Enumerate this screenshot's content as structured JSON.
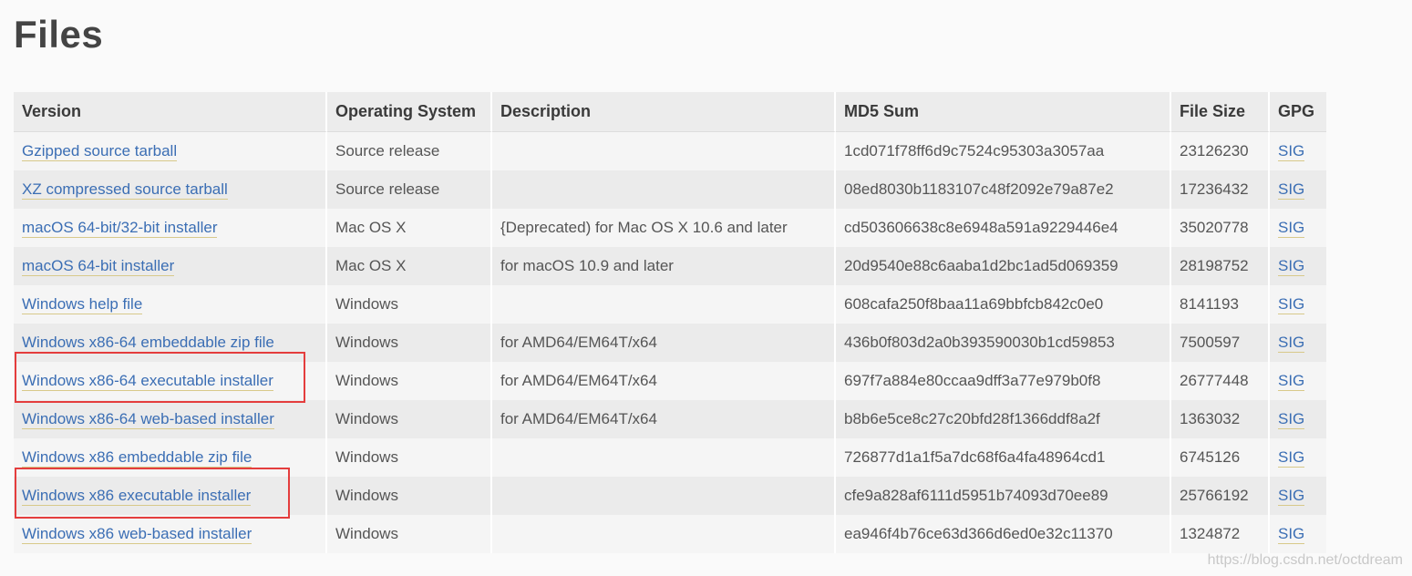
{
  "page": {
    "title": "Files",
    "watermark": "https://blog.csdn.net/octdream"
  },
  "table": {
    "headers": [
      "Version",
      "Operating System",
      "Description",
      "MD5 Sum",
      "File Size",
      "GPG"
    ],
    "rows": [
      {
        "version": "Gzipped source tarball",
        "os": "Source release",
        "description": "",
        "md5": "1cd071f78ff6d9c7524c95303a3057aa",
        "size": "23126230",
        "gpg": "SIG"
      },
      {
        "version": "XZ compressed source tarball",
        "os": "Source release",
        "description": "",
        "md5": "08ed8030b1183107c48f2092e79a87e2",
        "size": "17236432",
        "gpg": "SIG"
      },
      {
        "version": "macOS 64-bit/32-bit installer",
        "os": "Mac OS X",
        "description": "{Deprecated) for Mac OS X 10.6 and later",
        "md5": "cd503606638c8e6948a591a9229446e4",
        "size": "35020778",
        "gpg": "SIG"
      },
      {
        "version": "macOS 64-bit installer",
        "os": "Mac OS X",
        "description": "for macOS 10.9 and later",
        "md5": "20d9540e88c6aaba1d2bc1ad5d069359",
        "size": "28198752",
        "gpg": "SIG"
      },
      {
        "version": "Windows help file",
        "os": "Windows",
        "description": "",
        "md5": "608cafa250f8baa11a69bbfcb842c0e0",
        "size": "8141193",
        "gpg": "SIG"
      },
      {
        "version": "Windows x86-64 embeddable zip file",
        "os": "Windows",
        "description": "for AMD64/EM64T/x64",
        "md5": "436b0f803d2a0b393590030b1cd59853",
        "size": "7500597",
        "gpg": "SIG"
      },
      {
        "version": "Windows x86-64 executable installer",
        "os": "Windows",
        "description": "for AMD64/EM64T/x64",
        "md5": "697f7a884e80ccaa9dff3a77e979b0f8",
        "size": "26777448",
        "gpg": "SIG"
      },
      {
        "version": "Windows x86-64 web-based installer",
        "os": "Windows",
        "description": "for AMD64/EM64T/x64",
        "md5": "b8b6e5ce8c27c20bfd28f1366ddf8a2f",
        "size": "1363032",
        "gpg": "SIG"
      },
      {
        "version": "Windows x86 embeddable zip file",
        "os": "Windows",
        "description": "",
        "md5": "726877d1a1f5a7dc68f6a4fa48964cd1",
        "size": "6745126",
        "gpg": "SIG"
      },
      {
        "version": "Windows x86 executable installer",
        "os": "Windows",
        "description": "",
        "md5": "cfe9a828af6111d5951b74093d70ee89",
        "size": "25766192",
        "gpg": "SIG"
      },
      {
        "version": "Windows x86 web-based installer",
        "os": "Windows",
        "description": "",
        "md5": "ea946f4b76ce63d366d6ed0e32c11370",
        "size": "1324872",
        "gpg": "SIG"
      }
    ]
  },
  "annotations": {
    "highlight_color": "#e43d3d",
    "highlighted_rows": [
      "Windows x86-64 executable installer",
      "Windows x86 executable installer"
    ]
  }
}
